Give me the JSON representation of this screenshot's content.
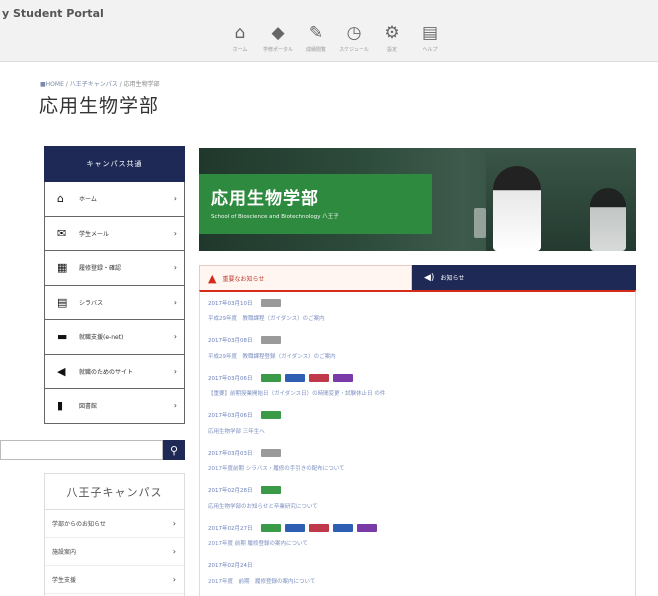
{
  "header": {
    "portal_title": "y Student Portal",
    "nav": [
      {
        "icon": "home-icon",
        "glyph": "⌂",
        "label": "ホーム"
      },
      {
        "icon": "diamond-icon",
        "glyph": "◆",
        "label": "学修ポータル"
      },
      {
        "icon": "pencil-icon",
        "glyph": "✎",
        "label": "成績閲覧"
      },
      {
        "icon": "clock-icon",
        "glyph": "◷",
        "label": "スケジュール"
      },
      {
        "icon": "gear-icon",
        "glyph": "⚙",
        "label": "設定"
      },
      {
        "icon": "calendar-icon",
        "glyph": "▤",
        "label": "ヘルプ"
      }
    ]
  },
  "breadcrumb": {
    "home": "■HOME",
    "sep1": " / ",
    "campus": "八王子キャンパス",
    "sep2": " / ",
    "current": "応用生物学部"
  },
  "page_title": "応用生物学部",
  "sidemenu": {
    "title": "キャンパス共通",
    "items": [
      {
        "icon": "home-icon",
        "glyph": "⌂",
        "label": "ホーム"
      },
      {
        "icon": "mail-icon",
        "glyph": "✉",
        "label": "学生メール"
      },
      {
        "icon": "table-icon",
        "glyph": "▦",
        "label": "履修登録・確認"
      },
      {
        "icon": "book-icon",
        "glyph": "▤",
        "label": "シラバス"
      },
      {
        "icon": "bag-icon",
        "glyph": "▬",
        "label": "就職支援(e-net)"
      },
      {
        "icon": "megaphone-icon",
        "glyph": "◀",
        "label": "就職のためのサイト"
      },
      {
        "icon": "library-icon",
        "glyph": "▮",
        "label": "図書館"
      }
    ]
  },
  "search": {
    "placeholder": "",
    "button_glyph": "⚲"
  },
  "campus": {
    "title": "八王子キャンパス",
    "items": [
      {
        "label": "学部からのお知らせ"
      },
      {
        "label": "施設案内"
      },
      {
        "label": "学生支援"
      }
    ]
  },
  "hero": {
    "title": "応用生物学部",
    "subtitle": "School of Bioscience and Biotechnology 八王子"
  },
  "tabs": {
    "important": {
      "icon": "warning-icon",
      "glyph": "▲",
      "label": "重要なお知らせ"
    },
    "notice": {
      "icon": "speaker-icon",
      "glyph": "◀)",
      "label": "お知らせ"
    }
  },
  "colors": {
    "navy": "#1e2a55",
    "green": "#2e8a3e",
    "red": "#d62a1a"
  },
  "news": [
    {
      "date": "2017年03月10日",
      "badges": [
        "#9a9a9a"
      ],
      "title": "平成29年度　教職課程（ガイダンス）のご案内"
    },
    {
      "date": "2017年03月08日",
      "badges": [
        "#9a9a9a"
      ],
      "title": "平成29年度　教職課程登録（ガイダンス）のご案内"
    },
    {
      "date": "2017年03月06日",
      "badges": [
        "#3a9a48",
        "#2f5fb3",
        "#c0394b",
        "#7a3aa8"
      ],
      "title": "【重要】前期授業開始日（ガイダンス日）の時間変更・試験休止日 の件"
    },
    {
      "date": "2017年03月06日",
      "badges": [
        "#3a9a48"
      ],
      "title": "応用生物学部 三年生へ"
    },
    {
      "date": "2017年03月03日",
      "badges": [
        "#9a9a9a"
      ],
      "title": "2017年度前期 シラバス・履修の手引きの配布について"
    },
    {
      "date": "2017年02月28日",
      "badges": [
        "#3a9a48"
      ],
      "title": "応用生物学部のお知らせと卒業研究について"
    },
    {
      "date": "2017年02月27日",
      "badges": [
        "#3a9a48",
        "#2f5fb3",
        "#c0394b",
        "#2f5fb3",
        "#7a3aa8"
      ],
      "title": "2017年度 前期 履修登録の案内について"
    },
    {
      "date": "2017年02月24日",
      "badges": [],
      "title": "2017年度　前期　履修登録の案内について"
    }
  ]
}
